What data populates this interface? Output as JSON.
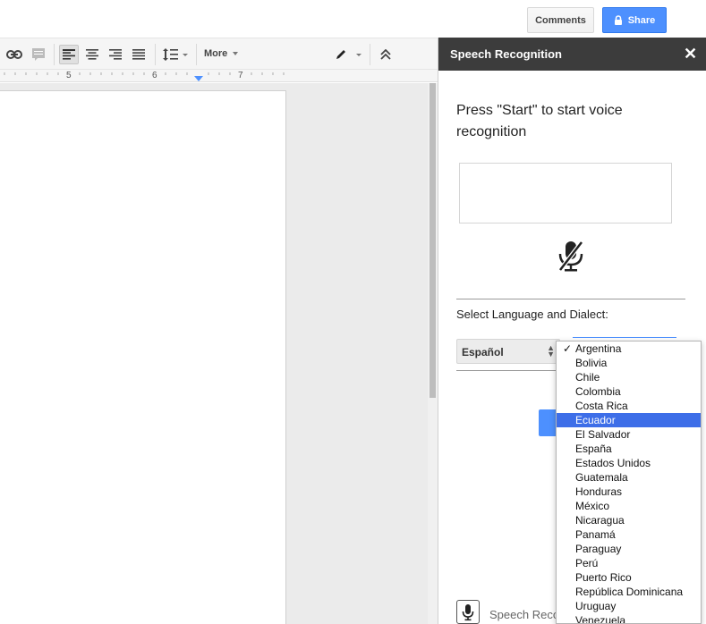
{
  "header": {
    "comments_label": "Comments",
    "share_label": "Share",
    "share_icon": "lock-icon"
  },
  "toolbar": {
    "more_label": "More",
    "icons": [
      "link-icon",
      "comment-icon",
      "align-left-icon",
      "align-center-icon",
      "align-right-icon",
      "align-justify-icon",
      "line-spacing-icon",
      "pencil-icon",
      "collapse-toolbar-icon"
    ]
  },
  "ruler": {
    "marks": [
      "5",
      "6",
      "7"
    ]
  },
  "sidebar": {
    "title": "Speech Recognition",
    "close_label": "✕",
    "instruction": "Press \"Start\" to start voice recognition",
    "mic_icon": "mic-off-icon",
    "language_label": "Select Language and Dialect:",
    "language_value": "Español",
    "footer_text": "Speech Reco"
  },
  "dialect_dropdown": {
    "checked": "Argentina",
    "highlighted": "Ecuador",
    "options": [
      "Argentina",
      "Bolivia",
      "Chile",
      "Colombia",
      "Costa Rica",
      "Ecuador",
      "El Salvador",
      "España",
      "Estados Unidos",
      "Guatemala",
      "Honduras",
      "México",
      "Nicaragua",
      "Panamá",
      "Paraguay",
      "Perú",
      "Puerto Rico",
      "República Dominicana",
      "Uruguay",
      "Venezuela"
    ]
  },
  "colors": {
    "share_blue": "#4d90fe",
    "sidebar_header": "#3c3c3c",
    "highlight": "#3d6ee8"
  }
}
